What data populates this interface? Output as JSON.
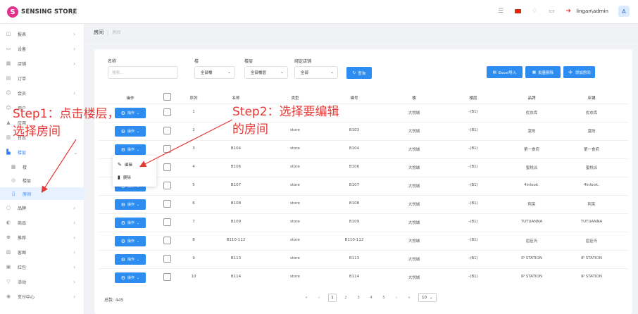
{
  "topbar": {
    "logo_mark": "S",
    "brand": "SENSING STORE",
    "collapse": "《",
    "user": "lingan\\admin",
    "avatar": "A"
  },
  "sidebar": {
    "items": [
      {
        "label": "报表",
        "icon": "chart-icon",
        "glyph": "◫"
      },
      {
        "label": "设备",
        "icon": "monitor-icon",
        "glyph": "▭"
      },
      {
        "label": "店铺",
        "icon": "store-icon",
        "glyph": "▦"
      },
      {
        "label": "订单",
        "icon": "order-icon",
        "glyph": "▤"
      },
      {
        "label": "会员",
        "icon": "member-icon",
        "glyph": "☺"
      },
      {
        "label": "用户",
        "icon": "user-icon",
        "glyph": "☺"
      },
      {
        "label": "应用",
        "icon": "app-icon",
        "glyph": "▲"
      },
      {
        "label": "日志",
        "icon": "log-icon",
        "glyph": "▥"
      },
      {
        "label": "楼层",
        "icon": "floor-icon",
        "glyph": "▙"
      },
      {
        "label": "楼",
        "icon": "building-icon",
        "glyph": "▦"
      },
      {
        "label": "楼层",
        "icon": "layers-icon",
        "glyph": "◎"
      },
      {
        "label": "房间",
        "icon": "room-icon",
        "glyph": "▯"
      },
      {
        "label": "品牌",
        "icon": "brand-icon",
        "glyph": "○"
      },
      {
        "label": "商品",
        "icon": "goods-icon",
        "glyph": "◐"
      },
      {
        "label": "推荐",
        "icon": "recommend-icon",
        "glyph": "♚"
      },
      {
        "label": "客图",
        "icon": "image-icon",
        "glyph": "▧"
      },
      {
        "label": "红包",
        "icon": "redpacket-icon",
        "glyph": "▣"
      },
      {
        "label": "活动",
        "icon": "activity-icon",
        "glyph": "▽"
      },
      {
        "label": "支付中心",
        "icon": "payment-icon",
        "glyph": "◉"
      }
    ]
  },
  "breadcrumb": {
    "first": "房间",
    "second": "房间"
  },
  "filters": {
    "name_label": "名称",
    "name_placeholder": "搜索...",
    "building_label": "楼",
    "building_value": "全部楼",
    "floor_label": "楼层",
    "floor_value": "全部楼层",
    "store_label": "绑定店铺",
    "store_value": "全部",
    "search_button": "查询"
  },
  "toolbar": {
    "excel_import": "Excel导入",
    "batch_delete": "批量删除",
    "add_room": "添加房间"
  },
  "table": {
    "headers": [
      "操作",
      "序列",
      "名称",
      "类型",
      "编号",
      "楼",
      "楼层",
      "品牌",
      "店铺"
    ],
    "op_label": "操作",
    "rows": [
      {
        "seq": "1",
        "name": "",
        "type": "",
        "code": "",
        "building": "大悦城",
        "floor": "-(B1)",
        "brand": "优衣库",
        "store": "优衣库"
      },
      {
        "seq": "2",
        "name": "",
        "type": "store",
        "code": "B103",
        "building": "大悦城",
        "floor": "-(B1)",
        "brand": "莫阳",
        "store": "莫阳"
      },
      {
        "seq": "3",
        "name": "B104",
        "type": "store",
        "code": "B104",
        "building": "大悦城",
        "floor": "-(B1)",
        "brand": "第一食府",
        "store": "第一食府"
      },
      {
        "seq": "4",
        "name": "B106",
        "type": "store",
        "code": "B106",
        "building": "大悦城",
        "floor": "-(B1)",
        "brand": "蜜桃派",
        "store": "蜜桃派"
      },
      {
        "seq": "5",
        "name": "B107",
        "type": "store",
        "code": "B107",
        "building": "大悦城",
        "floor": "-(B1)",
        "brand": "4inlook.",
        "store": "4inlook."
      },
      {
        "seq": "6",
        "name": "B108",
        "type": "store",
        "code": "B108",
        "building": "大悦城",
        "floor": "-(B1)",
        "brand": "阿芙",
        "store": "阿芙"
      },
      {
        "seq": "7",
        "name": "B109",
        "type": "store",
        "code": "B109",
        "building": "大悦城",
        "floor": "-(B1)",
        "brand": "TUTUANNA",
        "store": "TUTUANNA"
      },
      {
        "seq": "8",
        "name": "B110-112",
        "type": "store",
        "code": "B110-112",
        "building": "大悦城",
        "floor": "-(B1)",
        "brand": "屈臣氏",
        "store": "屈臣氏"
      },
      {
        "seq": "9",
        "name": "B113",
        "type": "store",
        "code": "B113",
        "building": "大悦城",
        "floor": "-(B1)",
        "brand": "IP STATION",
        "store": "IP STATION"
      },
      {
        "seq": "10",
        "name": "B114",
        "type": "store",
        "code": "B114",
        "building": "大悦城",
        "floor": "-(B1)",
        "brand": "IP STATION",
        "store": "IP STATION"
      }
    ]
  },
  "dropdown": {
    "edit": "编辑",
    "delete": "删除"
  },
  "pagination": {
    "total": "总数: 445",
    "prev_first": "«",
    "prev": "‹",
    "pages": [
      "1",
      "2",
      "3",
      "4",
      "5"
    ],
    "next": "›",
    "next_last": "»",
    "page_size": "10"
  },
  "annotations": {
    "step1_line1": "Step1：点击楼层，",
    "step1_line2": "选择房间",
    "step2_line1": "Step2：选择要编辑",
    "step2_line2": "的房间"
  },
  "colors": {
    "primary": "#2d8cf0",
    "annotation": "#e53935",
    "brand": "#e0318b"
  }
}
